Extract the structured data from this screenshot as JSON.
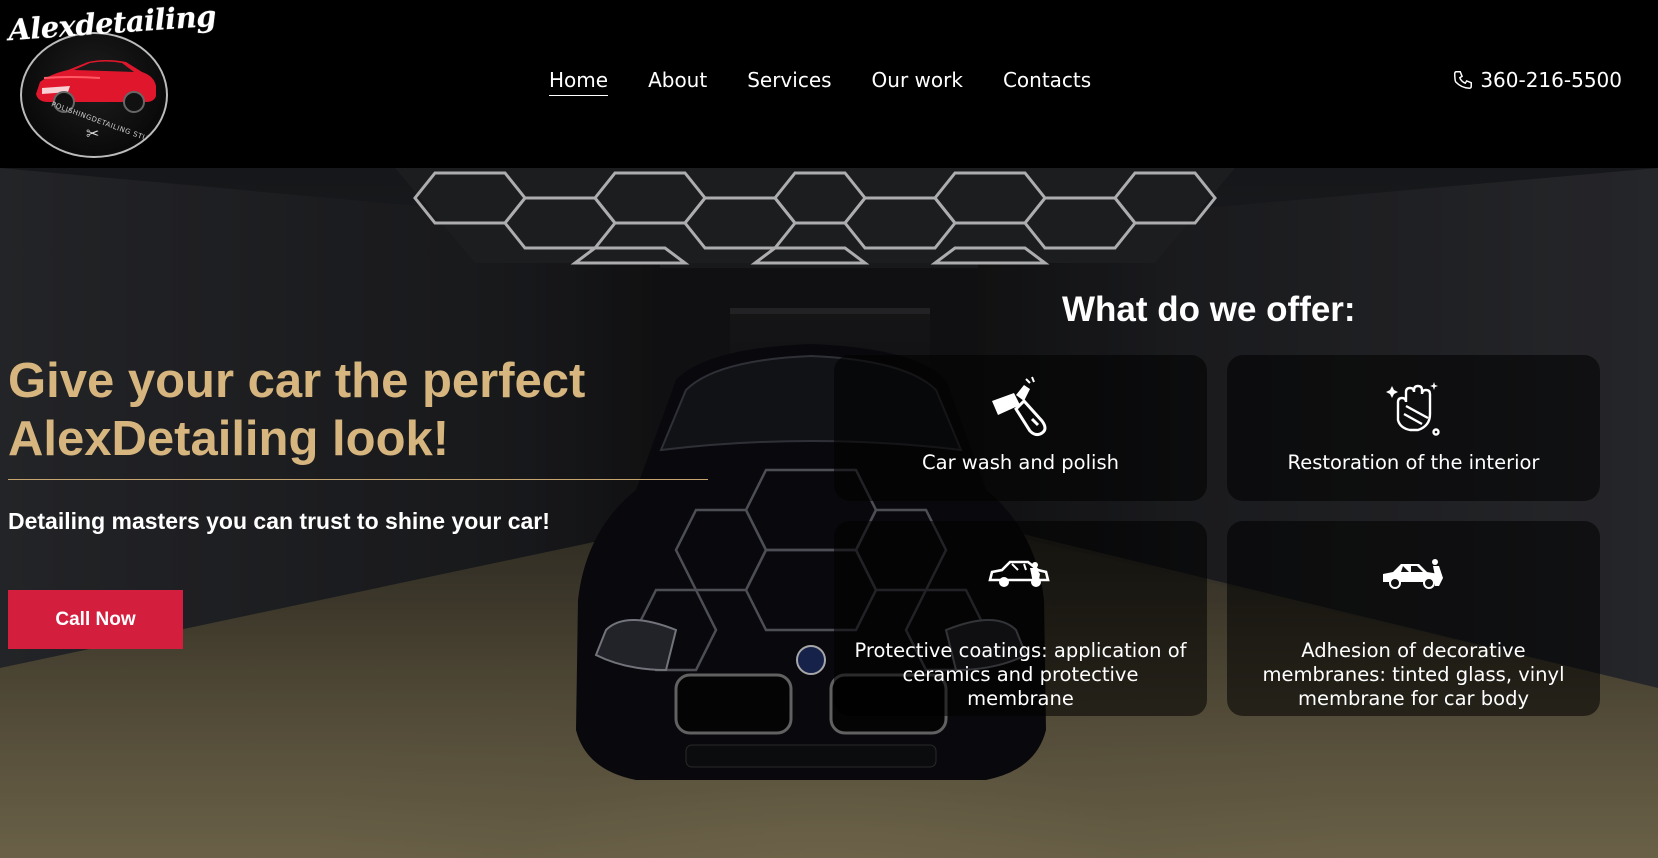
{
  "logo": {
    "script_text": "Alexdetailing",
    "ring_text": "POLISHINGDETAILING STUDIO"
  },
  "nav": {
    "items": [
      {
        "label": "Home",
        "active": true
      },
      {
        "label": "About"
      },
      {
        "label": "Services"
      },
      {
        "label": "Our work"
      },
      {
        "label": "Contacts"
      }
    ]
  },
  "phone": {
    "number": "360-216-5500",
    "icon": "phone-icon"
  },
  "hero": {
    "title_line1": "Give your car the perfect",
    "title_line2": "AlexDetailing look!",
    "subtitle": "Detailing masters you can trust to shine your car!",
    "cta_label": "Call Now"
  },
  "offers": {
    "title": "What do we offer:",
    "cards": [
      {
        "label": "Car wash and polish",
        "icon": "polisher-icon"
      },
      {
        "label": "Restoration of the interior",
        "icon": "cleaning-hand-icon"
      },
      {
        "label": "Protective coatings: application of ceramics and protective membrane",
        "icon": "car-coating-icon"
      },
      {
        "label": "Adhesion of decorative membranes: tinted glass, vinyl membrane for car body",
        "icon": "car-wrap-icon"
      }
    ]
  },
  "colors": {
    "accent_gold": "#d6b57f",
    "cta_red": "#d41e3e",
    "header_bg": "#000000"
  }
}
